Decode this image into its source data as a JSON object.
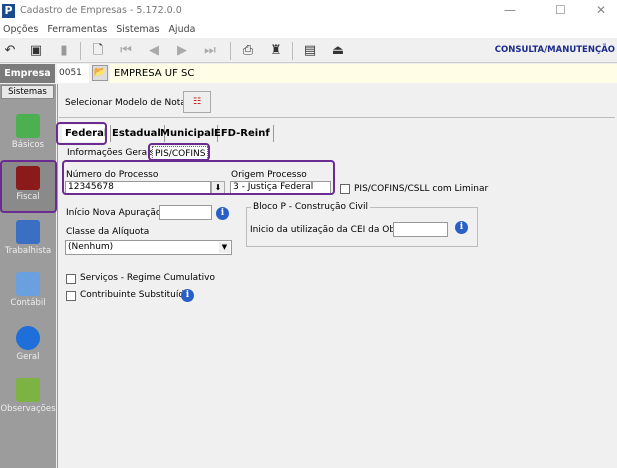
{
  "window": {
    "title": "Cadastro de Empresas - 5.172.0.0",
    "app_logo": "P"
  },
  "menu": [
    "Opções",
    "Ferramentas",
    "Sistemas",
    "Ajuda"
  ],
  "mode": "CONSULTA/MANUTENÇÃO",
  "empresa": {
    "label": "Empresa",
    "code": "0051",
    "name": "EMPRESA UF SC"
  },
  "sidebar": {
    "header": "Sistemas",
    "items": [
      {
        "label": "Básicos"
      },
      {
        "label": "Fiscal"
      },
      {
        "label": "Trabalhista"
      },
      {
        "label": "Contábil"
      },
      {
        "label": "Geral"
      },
      {
        "label": "Observações"
      }
    ]
  },
  "model": {
    "label": "Selecionar Modelo de Nota"
  },
  "tabs": [
    "Federal",
    "Estadual",
    "Municipal",
    "EFD-Reinf"
  ],
  "subtabs": [
    "Informações Gerais",
    "PIS/COFINS"
  ],
  "form": {
    "numero_label": "Número do Processo",
    "numero_value": "12345678",
    "origem_label": "Origem Processo",
    "origem_value": "3 - Justiça Federal",
    "liminar_label": "PIS/COFINS/CSLL com Liminar",
    "apuracao_label": "Início Nova Apuração:",
    "apuracao_value": "",
    "classe_label": "Classe da Alíquota",
    "classe_value": "(Nenhum)",
    "bloco_label": "Bloco P - Construção Civil",
    "cei_label": "Inicio da utilização da CEI da Obra:",
    "cei_value": "",
    "servicos_label": "Serviços - Regime Cumulativo",
    "substituto_label": "Contribuinte Substituído"
  }
}
